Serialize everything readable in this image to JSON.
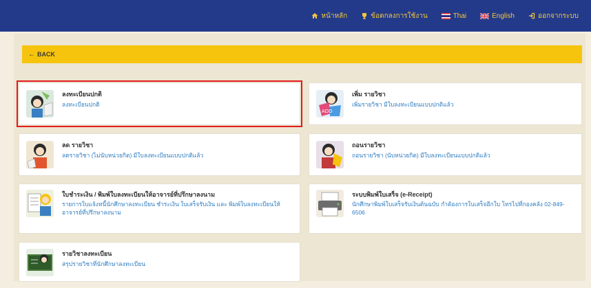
{
  "nav": {
    "home": "หน้าหลัก",
    "agreement": "ข้อตกลงการใช้งาน",
    "thai": "Thai",
    "english": "English",
    "logout": "ออกจากระบบ"
  },
  "back": {
    "label": "BACK"
  },
  "cards": [
    {
      "title": "ลงทะเบียนปกติ",
      "desc": "ลงทะเบียนปกติ"
    },
    {
      "title": "เพิ่ม รายวิชา",
      "desc": "เพิ่มรายวิชา มีใบลงทะเบียนแบบปกติแล้ว"
    },
    {
      "title": "ลด รายวิชา",
      "desc": "ลดรายวิชา (ไม่นับหน่วยกิต) มีใบลงทะเบียนแบบปกติแล้ว"
    },
    {
      "title": "ถอนรายวิชา",
      "desc": "ถอนรายวิชา (นับหน่วยกิต) มีใบลงทะเบียนแบบปกติแล้ว"
    },
    {
      "title": "ใบชำระเงิน / พิมพ์ใบลงทะเบียนให้อาจารย์ที่ปรึกษาลงนาม",
      "desc": "รายการใบแจ้งหนี้นักศึกษาลงทะเบียน ชำระเงิน ใบเสร็จรับเงิน และ พิมพ์ใบลงทะเบียนให้อาจารย์ที่ปรึกษาลงนาม"
    },
    {
      "title": "ระบบพิมพ์ใบเสร็จ (e-Receipt)",
      "desc": "นักศึกษาพิมพ์ใบเสร็จรับเงินต้นฉบับ กำต้องการใบเสร็จอีกใบ โทรไปที่กองคลัง 02-849-6506"
    },
    {
      "title": "รายวิชาลงทะเบียน",
      "desc": "สรุปรายวิชาที่นักศึกษาลงทะเบียน"
    }
  ],
  "colors": {
    "topbar": "#233a8a",
    "nav_text": "#f3c63c",
    "back_bar": "#f6c40d",
    "link_blue": "#2f7cc0",
    "highlight": "#e21a1a"
  }
}
